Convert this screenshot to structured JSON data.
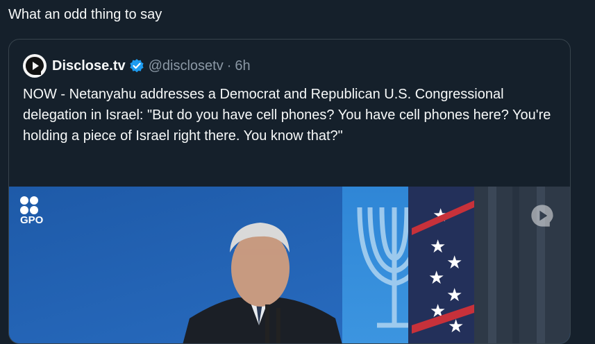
{
  "post": {
    "text": "What an odd thing to say"
  },
  "quoted": {
    "display_name": "Disclose.tv",
    "handle": "@disclosetv",
    "separator": "·",
    "time": "6h",
    "verified": true,
    "body": "NOW - Netanyahu addresses a Democrat and Republican U.S. Congressional delegation in Israel: \"But do you have cell phones? You have cell phones here? You're holding a piece of Israel right there. You know that?\"",
    "media": {
      "logo_text": "GPO"
    }
  },
  "colors": {
    "background": "#15202b",
    "border": "#38444d",
    "secondary_text": "#8b98a5",
    "verified_blue": "#1d9bf0"
  }
}
